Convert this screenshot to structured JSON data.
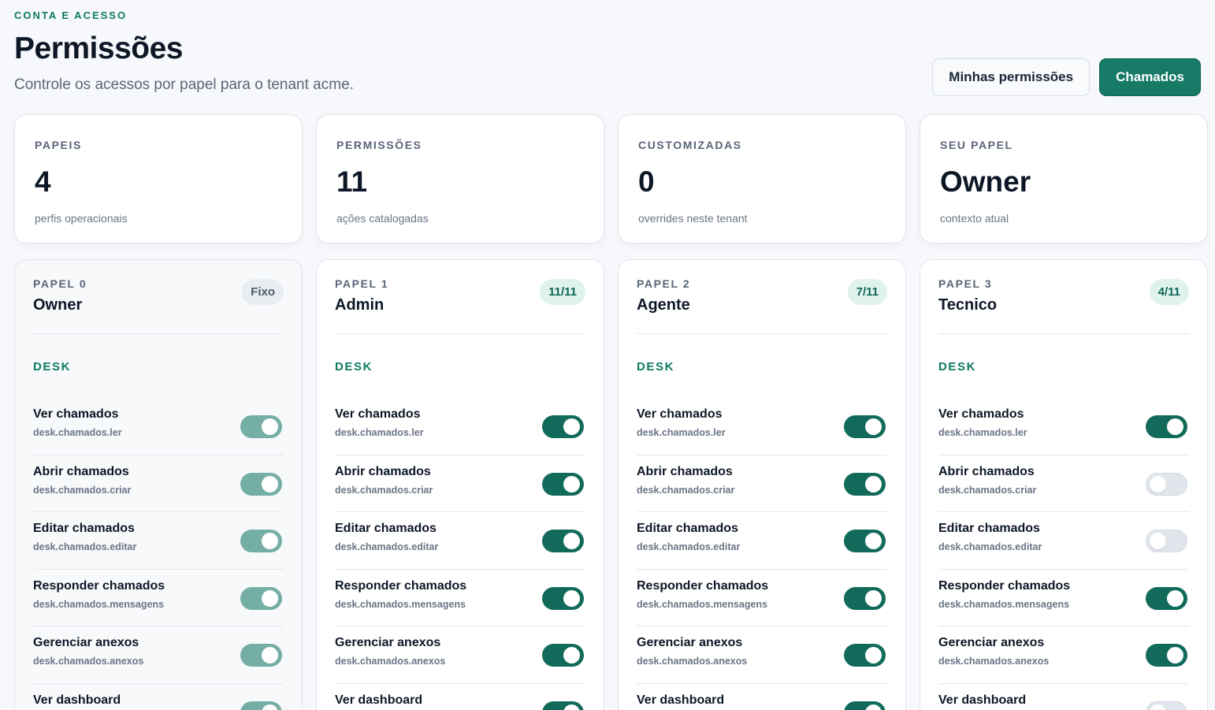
{
  "header": {
    "eyebrow": "CONTA E ACESSO",
    "title": "Permissões",
    "subtitle": "Controle os acessos por papel para o tenant acme."
  },
  "actions": {
    "my_permissions": "Minhas permissões",
    "tickets": "Chamados"
  },
  "stats": [
    {
      "label": "PAPEIS",
      "value": "4",
      "hint": "perfis operacionais"
    },
    {
      "label": "PERMISSÕES",
      "value": "11",
      "hint": "ações catalogadas"
    },
    {
      "label": "CUSTOMIZADAS",
      "value": "0",
      "hint": "overrides neste tenant"
    },
    {
      "label": "SEU PAPEL",
      "value": "Owner",
      "hint": "contexto atual"
    }
  ],
  "roles": [
    {
      "kicker": "PAPEL 0",
      "name": "Owner",
      "badge": "Fixo",
      "badge_kind": "fixed",
      "locked": true,
      "group": "DESK",
      "permissions": [
        {
          "name": "Ver chamados",
          "key": "desk.chamados.ler",
          "enabled": true
        },
        {
          "name": "Abrir chamados",
          "key": "desk.chamados.criar",
          "enabled": true
        },
        {
          "name": "Editar chamados",
          "key": "desk.chamados.editar",
          "enabled": true
        },
        {
          "name": "Responder chamados",
          "key": "desk.chamados.mensagens",
          "enabled": true
        },
        {
          "name": "Gerenciar anexos",
          "key": "desk.chamados.anexos",
          "enabled": true
        },
        {
          "name": "Ver dashboard",
          "key": "",
          "enabled": true
        }
      ]
    },
    {
      "kicker": "PAPEL 1",
      "name": "Admin",
      "badge": "11/11",
      "badge_kind": "count",
      "locked": false,
      "group": "DESK",
      "permissions": [
        {
          "name": "Ver chamados",
          "key": "desk.chamados.ler",
          "enabled": true
        },
        {
          "name": "Abrir chamados",
          "key": "desk.chamados.criar",
          "enabled": true
        },
        {
          "name": "Editar chamados",
          "key": "desk.chamados.editar",
          "enabled": true
        },
        {
          "name": "Responder chamados",
          "key": "desk.chamados.mensagens",
          "enabled": true
        },
        {
          "name": "Gerenciar anexos",
          "key": "desk.chamados.anexos",
          "enabled": true
        },
        {
          "name": "Ver dashboard",
          "key": "",
          "enabled": true
        }
      ]
    },
    {
      "kicker": "PAPEL 2",
      "name": "Agente",
      "badge": "7/11",
      "badge_kind": "count",
      "locked": false,
      "group": "DESK",
      "permissions": [
        {
          "name": "Ver chamados",
          "key": "desk.chamados.ler",
          "enabled": true
        },
        {
          "name": "Abrir chamados",
          "key": "desk.chamados.criar",
          "enabled": true
        },
        {
          "name": "Editar chamados",
          "key": "desk.chamados.editar",
          "enabled": true
        },
        {
          "name": "Responder chamados",
          "key": "desk.chamados.mensagens",
          "enabled": true
        },
        {
          "name": "Gerenciar anexos",
          "key": "desk.chamados.anexos",
          "enabled": true
        },
        {
          "name": "Ver dashboard",
          "key": "",
          "enabled": true
        }
      ]
    },
    {
      "kicker": "PAPEL 3",
      "name": "Tecnico",
      "badge": "4/11",
      "badge_kind": "count",
      "locked": false,
      "group": "DESK",
      "permissions": [
        {
          "name": "Ver chamados",
          "key": "desk.chamados.ler",
          "enabled": true
        },
        {
          "name": "Abrir chamados",
          "key": "desk.chamados.criar",
          "enabled": false
        },
        {
          "name": "Editar chamados",
          "key": "desk.chamados.editar",
          "enabled": false
        },
        {
          "name": "Responder chamados",
          "key": "desk.chamados.mensagens",
          "enabled": true
        },
        {
          "name": "Gerenciar anexos",
          "key": "desk.chamados.anexos",
          "enabled": true
        },
        {
          "name": "Ver dashboard",
          "key": "",
          "enabled": false
        }
      ]
    }
  ],
  "colors": {
    "accent": "#167a66",
    "toggle_on": "#126b5a",
    "toggle_disabled": "#75aea4",
    "toggle_off": "#e1e6ec"
  }
}
